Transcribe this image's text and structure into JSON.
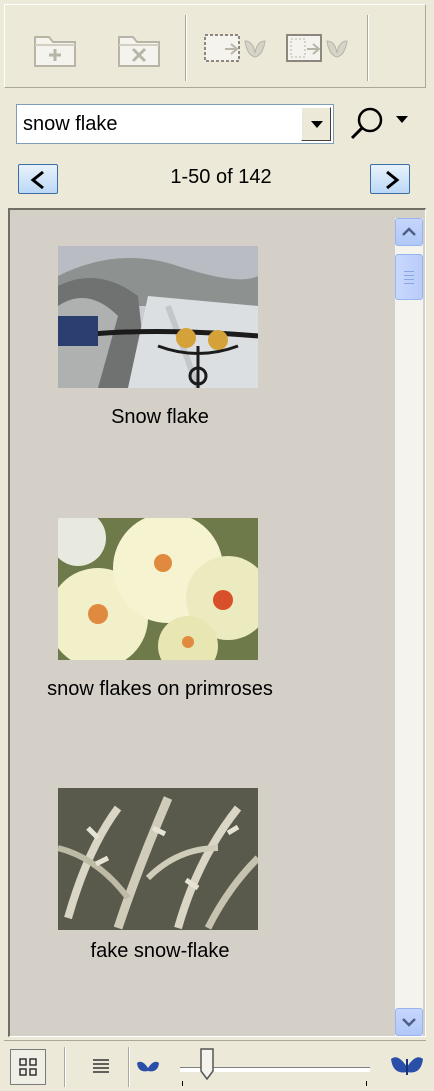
{
  "toolbar": {
    "buttons": [
      {
        "name": "new-folder",
        "icon": "folder-add-icon"
      },
      {
        "name": "delete",
        "icon": "folder-delete-icon"
      },
      {
        "name": "import-selection",
        "icon": "import-into-selection-icon"
      },
      {
        "name": "import-all",
        "icon": "import-all-icon"
      }
    ]
  },
  "search": {
    "value": "snow flake",
    "icon": "magnifier-icon"
  },
  "pager": {
    "prev_label": "<",
    "next_label": ">",
    "range_text": "1-50 of 142"
  },
  "results": {
    "items": [
      {
        "caption": "Snow flake",
        "thumbnail": "bicycle-handlebars-in-snow"
      },
      {
        "caption": "snow flakes on primroses",
        "thumbnail": "pale-yellow-primroses-with-snow"
      },
      {
        "caption": "fake snow-flake",
        "thumbnail": "silver-leaved-plant"
      }
    ]
  },
  "statusbar": {
    "grid_view_icon": "thumbnail-grid-icon",
    "list_view_icon": "list-view-icon",
    "zoom_min_icon": "small-butterfly-icon",
    "zoom_max_icon": "large-butterfly-icon",
    "zoom_level": 0.14
  },
  "colors": {
    "accent": "#3a6ea5",
    "pane_background": "#d4d0c8",
    "chrome": "#ece9d8",
    "butterfly": "#2a4fa8"
  }
}
